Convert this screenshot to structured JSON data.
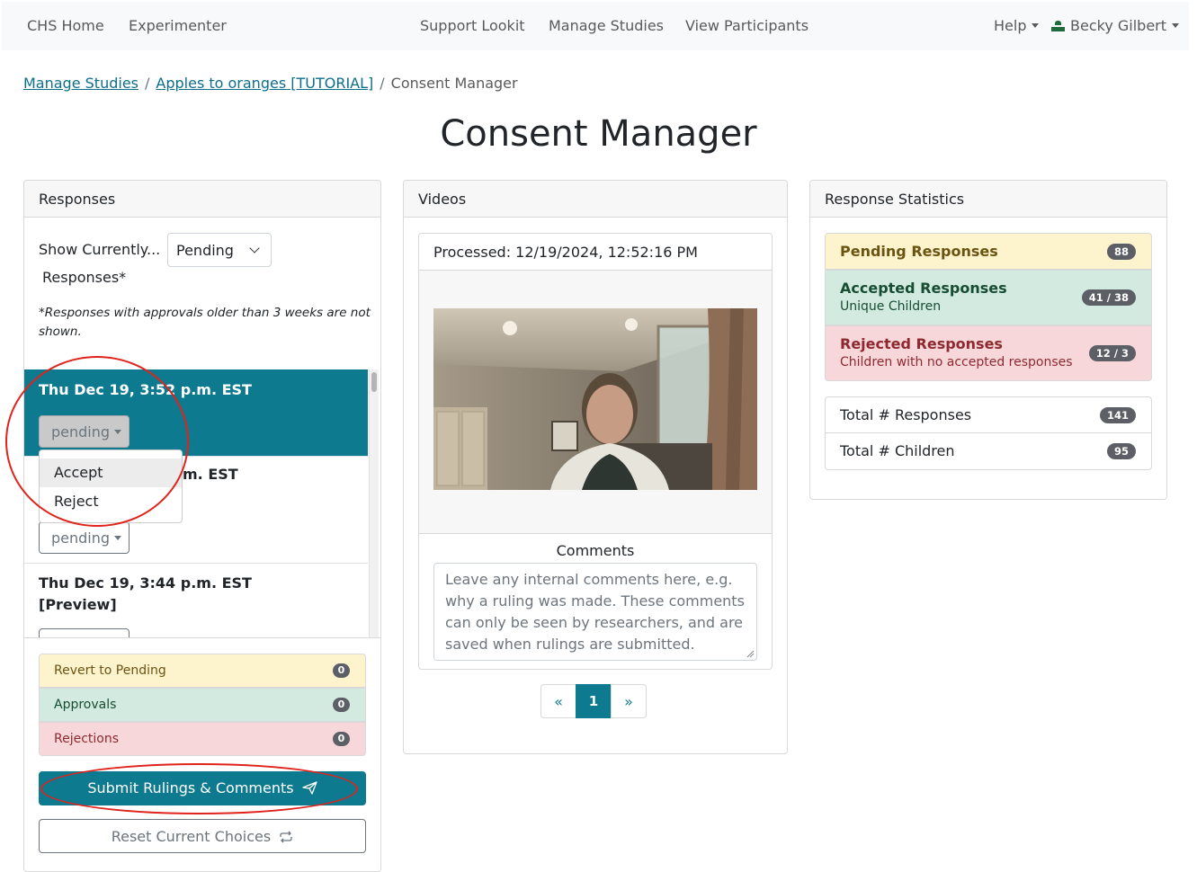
{
  "nav": {
    "home": "CHS Home",
    "experimenter": "Experimenter",
    "support": "Support Lookit",
    "manage": "Manage Studies",
    "participants": "View Participants",
    "help": "Help",
    "user": "Becky Gilbert"
  },
  "breadcrumb": {
    "level1": "Manage Studies",
    "level2": "Apples to oranges [TUTORIAL]",
    "current": "Consent Manager"
  },
  "page_title": "Consent Manager",
  "responses": {
    "header": "Responses",
    "show_label": "Show Currently...",
    "show_label_suffix": "Responses*",
    "filter_value": "Pending",
    "note": "*Responses with approvals older than 3 weeks are not shown.",
    "items": [
      {
        "date": "Thu Dec 19, 3:52 p.m. EST",
        "status": "pending"
      },
      {
        "date_visible_fragment": "m. EST",
        "status": "pending"
      },
      {
        "date": "Thu Dec 19, 3:44 p.m. EST",
        "tag": "[Preview]"
      }
    ],
    "dropdown": {
      "accept": "Accept",
      "reject": "Reject"
    },
    "tallies": {
      "revert": {
        "label": "Revert to Pending",
        "count": "0"
      },
      "approvals": {
        "label": "Approvals",
        "count": "0"
      },
      "rejections": {
        "label": "Rejections",
        "count": "0"
      }
    },
    "submit_label": "Submit Rulings & Comments",
    "reset_label": "Reset Current Choices"
  },
  "videos": {
    "header": "Videos",
    "processed": "Processed: 12/19/2024, 12:52:16 PM",
    "comments_label": "Comments",
    "comments_placeholder": "Leave any internal comments here, e.g. why a ruling was made. These comments can only be seen by researchers, and are saved when rulings are submitted.",
    "pagination": {
      "prev": "«",
      "current": "1",
      "next": "»"
    }
  },
  "stats": {
    "header": "Response Statistics",
    "pending": {
      "label": "Pending Responses",
      "count": "88"
    },
    "accepted": {
      "label": "Accepted Responses",
      "sub": "Unique Children",
      "count": "41 / 38"
    },
    "rejected": {
      "label": "Rejected Responses",
      "sub": "Children with no accepted responses",
      "count": "12 / 3"
    },
    "total_responses": {
      "label": "Total # Responses",
      "count": "141"
    },
    "total_children": {
      "label": "Total # Children",
      "count": "95"
    }
  },
  "colors": {
    "primary": "#0d7a8f",
    "pending_bg": "#fdf3cd",
    "accepted_bg": "#d2eadf",
    "rejected_bg": "#f8d7da",
    "annotation": "#e0231b"
  }
}
